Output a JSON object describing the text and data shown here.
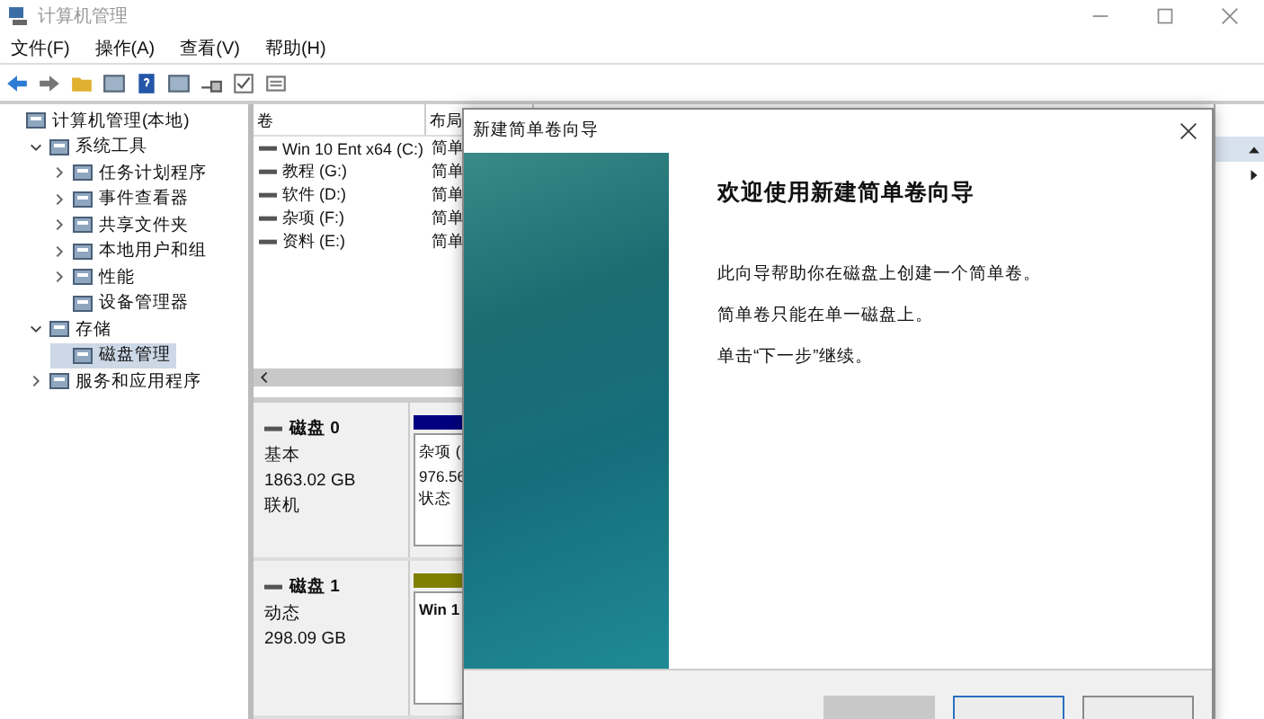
{
  "window": {
    "title": "计算机管理"
  },
  "menu": [
    "文件(F)",
    "操作(A)",
    "查看(V)",
    "帮助(H)"
  ],
  "tree": [
    {
      "label": "计算机管理(本地)",
      "selected": false,
      "children": [
        {
          "label": "系统工具",
          "expanded": true,
          "selected": false,
          "children": [
            {
              "label": "任务计划程序",
              "expanded": false,
              "selected": false
            },
            {
              "label": "事件查看器",
              "expanded": false,
              "selected": false
            },
            {
              "label": "共享文件夹",
              "expanded": false,
              "selected": false
            },
            {
              "label": "本地用户和组",
              "expanded": false,
              "selected": false
            },
            {
              "label": "性能",
              "expanded": false,
              "selected": false
            },
            {
              "label": "设备管理器",
              "selected": false
            }
          ]
        },
        {
          "label": "存储",
          "expanded": true,
          "selected": false,
          "children": [
            {
              "label": "磁盘管理",
              "selected": true
            }
          ]
        },
        {
          "label": "服务和应用程序",
          "expanded": false,
          "selected": false
        }
      ]
    }
  ],
  "volumes": {
    "columns": [
      "卷",
      "布局"
    ],
    "rows": [
      [
        "Win 10 Ent x64 (C:)",
        "简单"
      ],
      [
        "教程 (G:)",
        "简单"
      ],
      [
        "软件 (D:)",
        "简单"
      ],
      [
        "杂项 (F:)",
        "简单"
      ],
      [
        "资料 (E:)",
        "简单"
      ]
    ]
  },
  "disks": [
    {
      "name": "磁盘 0",
      "type": "基本",
      "size": "1863.02 GB",
      "status": "联机",
      "color": "#000080",
      "partition": [
        "杂项 (",
        "976.56",
        "状态"
      ]
    },
    {
      "name": "磁盘 1",
      "type": "动态",
      "size": "298.09 GB",
      "color": "#808000",
      "partition": [
        "Win 1"
      ]
    }
  ],
  "dialog": {
    "title": "新建简单卷向导",
    "heading": "欢迎使用新建简单卷向导",
    "paragraphs": [
      "此向导帮助你在磁盘上创建一个简单卷。",
      "简单卷只能在单一磁盘上。",
      "单击“下一步”继续。"
    ],
    "buttons": [
      {
        "kind": "back",
        "disabled": true
      },
      {
        "kind": "next",
        "disabled": false
      },
      {
        "kind": "cancel",
        "disabled": false
      }
    ]
  }
}
